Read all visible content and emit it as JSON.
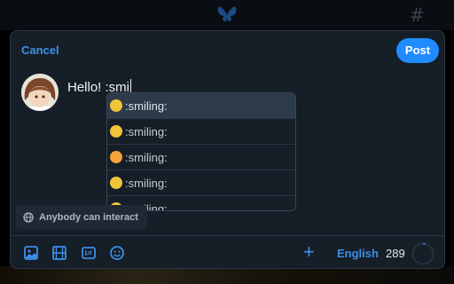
{
  "composer": {
    "cancel_label": "Cancel",
    "post_label": "Post",
    "text": "Hello! :smi"
  },
  "autocomplete": {
    "items": [
      {
        "label": ":smiling:",
        "emoji_color": "#f0c43a",
        "selected": true
      },
      {
        "label": ":smiling:",
        "emoji_color": "#f0c43a",
        "selected": false
      },
      {
        "label": ":smiling:",
        "emoji_color": "#f2a33a",
        "selected": false
      },
      {
        "label": ":smiling:",
        "emoji_color": "#f0c43a",
        "selected": false
      },
      {
        "label": ":smiling:",
        "emoji_color": "#f0c43a",
        "selected": false
      }
    ]
  },
  "interaction": {
    "label": "Anybody can interact"
  },
  "toolbar": {
    "icons": [
      "image-icon",
      "video-icon",
      "gif-icon",
      "emoji-icon"
    ],
    "add_label": "+",
    "language": "English",
    "char_count": "289",
    "char_progress": 0.04
  },
  "colors": {
    "accent": "#208bfe",
    "link": "#3d8fe8",
    "modal_bg": "#161e27"
  }
}
